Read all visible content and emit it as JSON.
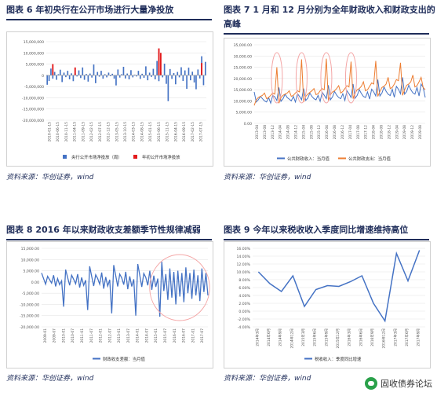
{
  "panels": {
    "p1": {
      "title": "图表 6   年初央行在公开市场进行大量净投放",
      "source": "资料来源：华创证券，wind"
    },
    "p2": {
      "title1": "图表 7   1 月和 12 月分别为全年财政收入和财政支出的",
      "title2": "高峰",
      "source": "资料来源：华创证券，wind"
    },
    "p3": {
      "title": "图表 8   2016 年以来财政收支差额季节性规律减弱",
      "source": "资料来源：华创证券，wind"
    },
    "p4": {
      "title": "图表 9   今年以来税收收入季度同比增速维持高位",
      "source": "资料来源：华创证券，wind"
    }
  },
  "watermark": {
    "text": "固收债券论坛"
  },
  "colors": {
    "blue": "#4472c4",
    "orange": "#ed7d31",
    "red": "#e31a1c",
    "title": "#1f2d5a",
    "highlight": "#f4a6a6"
  },
  "chart_data": [
    {
      "type": "bar",
      "title": "",
      "ylim": [
        -20000000,
        15000000
      ],
      "yticks": [
        "15,000,000",
        "10,000,000",
        "5,000,000",
        "0",
        "-5,000,000",
        "-10,000,000",
        "-15,000,000",
        "-20,000,000"
      ],
      "yticks_values": [
        15000000,
        10000000,
        5000000,
        0,
        -5000000,
        -10000000,
        -15000000,
        -20000000
      ],
      "xticks": [
        "2010-01-15",
        "2010-06-15",
        "2010-11-15",
        "2011-04-15",
        "2011-09-15",
        "2012-02-15",
        "2012-07-15",
        "2012-12-15",
        "2013-05-15",
        "2013-10-15",
        "2014-03-15",
        "2014-08-15",
        "2015-01-15",
        "2015-06-15",
        "2015-11-15",
        "2016-04-15",
        "2016-09-15",
        "2017-02-15",
        "2017-07-15"
      ],
      "series": [
        {
          "name": "央行公开市场净投放（周）",
          "color": "#4472c4",
          "values": [
            -4200000,
            -2500000,
            3000000,
            -1500000,
            1500000,
            -2000000,
            500000,
            2500000,
            -3000000,
            1200000,
            -800000,
            2000000,
            -1800000,
            900000,
            -2600000,
            1000000,
            -500000,
            2200000,
            -1200000,
            3500000,
            -2000000,
            600000,
            -2800000,
            800000,
            -1000000,
            4800000,
            -3500000,
            1500000,
            -600000,
            2000000,
            -1500000,
            500000,
            -900000,
            1200000,
            -400000,
            700000,
            -1500000,
            -4500000,
            2600000,
            -1000000,
            500000,
            3800000,
            -1400000,
            800000,
            -1800000,
            2300000,
            -900000,
            300000,
            -500000,
            2000000,
            -1600000,
            700000,
            -1100000,
            4000000,
            -2200000,
            1200000,
            -700000,
            2900000,
            -1800000,
            6400000,
            -2600000,
            1400000,
            -900000,
            5200000,
            -3800000,
            -11500000,
            2800000,
            -1600000,
            1000000,
            -4000000,
            1500000,
            -900000,
            3600000,
            -2500000,
            2200000,
            -6000000,
            3400000,
            -2200000,
            1600000,
            -3200000,
            -6200000,
            2600000,
            -1400000,
            8500000,
            -4400000,
            6000000
          ]
        },
        {
          "name": "年初公开市场净投放",
          "color": "#e31a1c",
          "values": [
            null,
            null,
            null,
            null,
            null,
            null,
            null,
            null,
            null,
            null,
            null,
            null,
            null,
            null,
            null,
            null,
            null,
            null,
            null,
            null,
            null,
            null,
            null,
            null,
            null,
            null,
            null,
            null,
            null,
            null,
            null,
            null,
            null,
            null,
            null,
            null,
            null,
            null,
            null,
            null,
            null,
            null,
            null,
            null,
            null,
            null,
            null,
            null,
            null,
            null,
            null,
            null,
            null,
            null,
            null,
            null,
            null,
            null,
            null,
            null,
            null,
            null,
            null,
            null,
            null,
            null,
            null,
            null,
            null,
            null,
            null,
            null,
            null,
            null,
            null,
            null,
            null,
            null,
            null,
            null,
            null,
            null,
            null,
            null,
            null,
            null
          ]
        }
      ],
      "red_bars": [
        {
          "index": 3,
          "value": 5000000
        },
        {
          "index": 15,
          "value": 3500000
        },
        {
          "index": 60,
          "value": 12000000
        },
        {
          "index": 61,
          "value": 10000000
        },
        {
          "index": 83,
          "value": 5500000
        }
      ]
    },
    {
      "type": "line",
      "title": "",
      "ylim": [
        0,
        35000
      ],
      "yticks": [
        "35,000.00",
        "30,000.00",
        "25,000.00",
        "20,000.00",
        "15,000.00",
        "10,000.00",
        "5,000.00",
        "0.00"
      ],
      "yticks_values": [
        35000,
        30000,
        25000,
        20000,
        15000,
        10000,
        5000,
        0
      ],
      "xticks": [
        "2013-04",
        "2013-08",
        "2013-12",
        "2014-04",
        "2014-08",
        "2014-12",
        "2015-04",
        "2015-08",
        "2015-12",
        "2016-04",
        "2016-08",
        "2016-12",
        "2017-04",
        "2017-08",
        "2017-12",
        "2018-04",
        "2018-08",
        "2018-12",
        "2019-04",
        "2019-08",
        "2019-12",
        "2019-08"
      ],
      "series": [
        {
          "name": "公共财政收入：当月值",
          "color": "#4472c4",
          "values": [
            14000,
            9500,
            10500,
            12000,
            11000,
            10000,
            9500,
            11500,
            9000,
            12500,
            11800,
            10200,
            16000,
            9800,
            11000,
            13000,
            11500,
            10800,
            10000,
            12000,
            9500,
            13200,
            12000,
            10500,
            15500,
            10200,
            11200,
            13500,
            12000,
            11000,
            10500,
            12500,
            9800,
            13800,
            12500,
            11000,
            17000,
            10500,
            11800,
            14200,
            12600,
            11500,
            11000,
            13200,
            10200,
            14500,
            13200,
            11500,
            17500,
            11200,
            12500,
            15000,
            13300,
            12000,
            11500,
            14000,
            10800,
            15200,
            14000,
            12200,
            19500,
            12200,
            13500,
            16200,
            14300,
            13000,
            12400,
            15200,
            11600,
            16500,
            15200,
            13200,
            20500,
            13000,
            14200,
            17000,
            15000,
            13600,
            13000,
            16000,
            12200,
            17500,
            16000,
            11500
          ]
        },
        {
          "name": "公共财政支出：当月值",
          "color": "#ed7d31",
          "values": [
            8000,
            10500,
            11500,
            12000,
            12500,
            13500,
            11000,
            11500,
            12500,
            13500,
            13000,
            25000,
            9000,
            11500,
            12500,
            13000,
            13500,
            14500,
            12000,
            12500,
            13500,
            14500,
            14000,
            28500,
            9500,
            12000,
            13000,
            13800,
            14500,
            15500,
            12800,
            13200,
            14500,
            15500,
            15000,
            28800,
            10200,
            12800,
            14000,
            14500,
            15500,
            16800,
            13500,
            14200,
            15500,
            16800,
            16200,
            27500,
            11000,
            13500,
            15000,
            15500,
            16500,
            18500,
            14500,
            15000,
            16500,
            18000,
            17500,
            27800,
            12000,
            14200,
            16000,
            16500,
            17500,
            20500,
            15500,
            16000,
            17500,
            19500,
            19000,
            27000,
            12500,
            15000,
            17000,
            17500,
            18500,
            21500,
            16200,
            16800,
            18500,
            20500,
            16000,
            15000
          ]
        }
      ],
      "highlights": [
        "ellipse-1",
        "ellipse-2",
        "ellipse-3",
        "ellipse-4"
      ]
    },
    {
      "type": "line",
      "title": "",
      "ylim": [
        -20000,
        15000
      ],
      "yticks": [
        "15,000.00",
        "10,000.00",
        "5,000.00",
        "0.00",
        "-5,000.00",
        "-10,000.00",
        "-15,000.00",
        "-20,000.00"
      ],
      "yticks_values": [
        15000,
        10000,
        5000,
        0,
        -5000,
        -10000,
        -15000,
        -20000
      ],
      "xticks": [
        "2009-01",
        "2009-07",
        "2010-01",
        "2010-07",
        "2011-01",
        "2011-07",
        "2012-01",
        "2012-07",
        "2013-01",
        "2013-07",
        "2014-01",
        "2014-07",
        "2015-01",
        "2015-07",
        "2016-01",
        "2016-07",
        "2017-01",
        "2017-07"
      ],
      "series": [
        {
          "name": "财政收支差额：当月值",
          "color": "#4472c4",
          "values": [
            4000,
            1500,
            -1000,
            2500,
            1000,
            -500,
            3000,
            -2000,
            1500,
            -1200,
            500,
            -11000,
            5500,
            2000,
            -1500,
            3000,
            1200,
            -800,
            3500,
            -2500,
            2000,
            -1500,
            800,
            -12500,
            7000,
            2500,
            -1800,
            3200,
            1500,
            -1000,
            4200,
            -3000,
            2200,
            -1800,
            1000,
            -14000,
            7500,
            2800,
            -2000,
            3500,
            1800,
            -1200,
            4500,
            -3200,
            2500,
            -2000,
            1200,
            -15000,
            8000,
            3000,
            -2200,
            3800,
            2000,
            -1500,
            5000,
            -3500,
            2800,
            -2200,
            1500,
            -15500,
            9000,
            -4000,
            3500,
            -8000,
            6000,
            -7000,
            4500,
            -10000,
            5000,
            -6500,
            4000,
            -9000,
            6500,
            -5000,
            4000,
            -7500,
            5500,
            -6000,
            3000,
            -8500,
            6000,
            -4500,
            4000,
            -6000
          ]
        }
      ]
    },
    {
      "type": "line",
      "title": "",
      "ylim": [
        -0.04,
        0.16
      ],
      "yticks": [
        "16.00%",
        "14.00%",
        "12.00%",
        "10.00%",
        "8.00%",
        "6.00%",
        "4.00%",
        "2.00%",
        "0.00%",
        "-2.00%",
        "-4.00%"
      ],
      "yticks_values": [
        0.16,
        0.14,
        0.12,
        0.1,
        0.08,
        0.06,
        0.04,
        0.02,
        0.0,
        -0.02,
        -0.04
      ],
      "categories": [
        "2014年3月",
        "2014年6月",
        "2014年9月",
        "2014年12月",
        "2015年3月",
        "2015年6月",
        "2015年9月",
        "2015年12月",
        "2016年3月",
        "2016年6月",
        "2016年9月",
        "2016年12月",
        "2017年3月",
        "2017年6月",
        "2017年9月"
      ],
      "series": [
        {
          "name": "税收收入：季度同比增速",
          "color": "#4472c4",
          "values": [
            0.1,
            0.07,
            0.05,
            0.09,
            0.012,
            0.055,
            0.065,
            0.063,
            0.075,
            0.09,
            0.02,
            -0.025,
            0.147,
            0.077,
            0.155
          ]
        }
      ]
    }
  ]
}
